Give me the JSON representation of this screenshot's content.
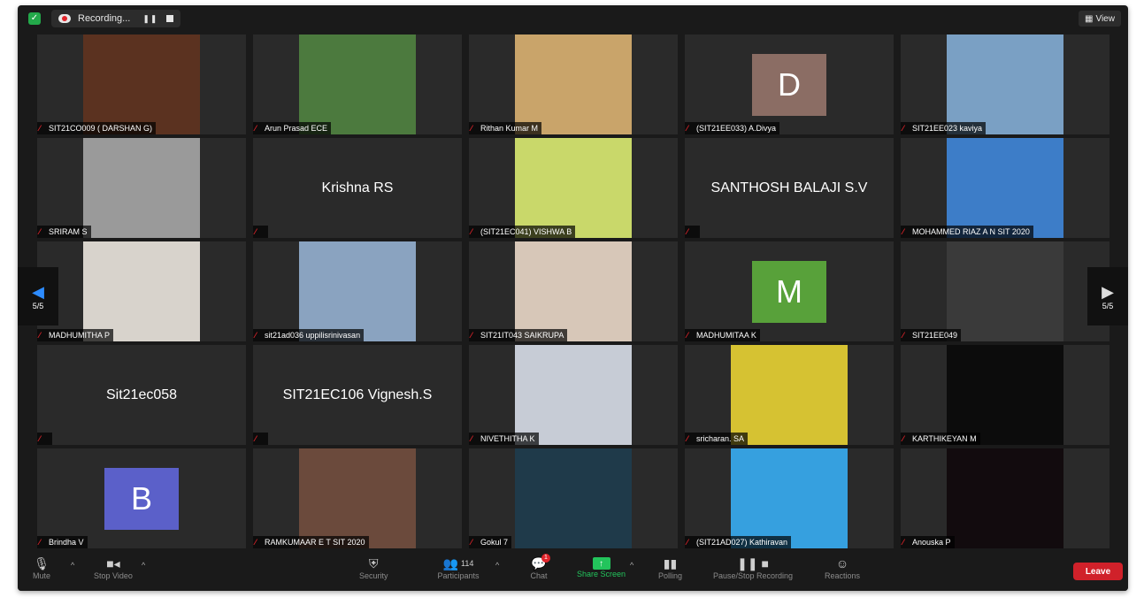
{
  "topbar": {
    "recording_label": "Recording...",
    "view_label": "View"
  },
  "page_indicator": {
    "left": "5/5",
    "right": "5/5"
  },
  "participants": [
    {
      "name": "SIT21CO009 ( DARSHAN G)",
      "display": "photo",
      "photo_color": "#5b3220"
    },
    {
      "name": "Arun Prasad ECE",
      "display": "photo",
      "photo_color": "#4c7a3e"
    },
    {
      "name": "Rithan Kumar M",
      "display": "photo",
      "photo_color": "#c9a46a"
    },
    {
      "name": "(SIT21EE033) A.Divya",
      "display": "avatar",
      "letter": "D",
      "color": "#8b6d64"
    },
    {
      "name": "SIT21EE023 kaviya",
      "display": "photo",
      "photo_color": "#7aa0c4"
    },
    {
      "name": "SRIRAM S",
      "display": "photo",
      "photo_color": "#9a9a9a"
    },
    {
      "name": "",
      "display": "text",
      "big_name": "Krishna RS"
    },
    {
      "name": "(SIT21EC041) VISHWA B",
      "display": "photo",
      "photo_color": "#c9d86a"
    },
    {
      "name": "",
      "display": "text",
      "big_name": "SANTHOSH BALAJI S.V"
    },
    {
      "name": "MOHAMMED RIAZ A N SIT 2020",
      "display": "photo",
      "photo_color": "#3d7dc8"
    },
    {
      "name": "MADHUMITHA P",
      "display": "photo",
      "photo_color": "#d8d3cc"
    },
    {
      "name": "sit21ad036 uppilisrinivasan",
      "display": "photo",
      "photo_color": "#8aa3c0"
    },
    {
      "name": "SIT21IT043 SAIKRUPA",
      "display": "photo",
      "photo_color": "#d7c7b8"
    },
    {
      "name": "MADHUMITAA K",
      "display": "avatar",
      "letter": "M",
      "color": "#58a13a"
    },
    {
      "name": "SIT21EE049",
      "display": "photo",
      "photo_color": "#3a3a3a"
    },
    {
      "name": "",
      "display": "text",
      "big_name": "Sit21ec058"
    },
    {
      "name": "",
      "display": "text",
      "big_name": "SIT21EC106 Vignesh.S"
    },
    {
      "name": "NIVETHITHA K",
      "display": "photo",
      "photo_color": "#c7ccd6"
    },
    {
      "name": "sricharan. SA",
      "display": "photo",
      "photo_color": "#d6c232"
    },
    {
      "name": "KARTHIKEYAN M",
      "display": "photo",
      "photo_color": "#0c0c0c"
    },
    {
      "name": "Brindha V",
      "display": "avatar",
      "letter": "B",
      "color": "#5b60c9"
    },
    {
      "name": "RAMKUMAAR E T SIT 2020",
      "display": "photo",
      "photo_color": "#6b4a3c"
    },
    {
      "name": "Gokul 7",
      "display": "photo",
      "photo_color": "#1f3a4a"
    },
    {
      "name": "(SIT21AD027) Kathiravan",
      "display": "photo",
      "photo_color": "#36a0df"
    },
    {
      "name": "Anouska P",
      "display": "photo",
      "photo_color": "#120b0e"
    }
  ],
  "toolbar": {
    "mute": "Mute",
    "stop_video": "Stop Video",
    "security": "Security",
    "participants": "Participants",
    "participant_count": "114",
    "chat": "Chat",
    "chat_badge": "1",
    "share_screen": "Share Screen",
    "polling": "Polling",
    "pause_stop_recording": "Pause/Stop Recording",
    "reactions": "Reactions",
    "leave": "Leave"
  }
}
